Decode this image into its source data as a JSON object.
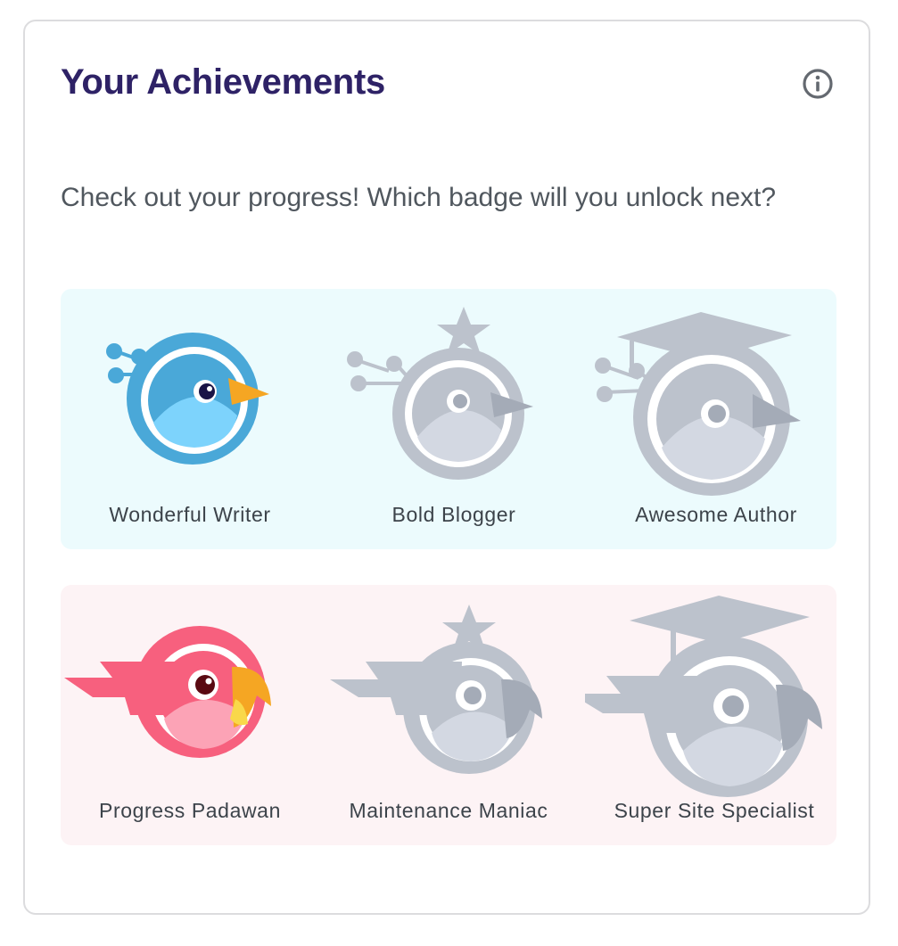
{
  "card": {
    "title": "Your Achievements",
    "info_icon": "info-circle-icon",
    "description": "Check out your progress! Which badge will you unlock next?"
  },
  "colors": {
    "title": "#2e2266",
    "locked_gray": "#bcc2cc",
    "writer_blue": "#4aa8d8",
    "padawan_pink": "#f7607e",
    "panel_blue_bg": "#ecfbfd",
    "panel_pink_bg": "#fdf3f5"
  },
  "badge_rows": [
    {
      "theme": "blue",
      "badges": [
        {
          "name": "Wonderful Writer",
          "icon": "writer-bird-icon",
          "unlocked": true
        },
        {
          "name": "Bold Blogger",
          "icon": "blogger-bird-star-icon",
          "unlocked": false
        },
        {
          "name": "Awesome Author",
          "icon": "author-bird-graduation-cap-icon",
          "unlocked": false
        }
      ]
    },
    {
      "theme": "pink",
      "badges": [
        {
          "name": "Progress Padawan",
          "icon": "padawan-parrot-icon",
          "unlocked": true
        },
        {
          "name": "Maintenance Maniac",
          "icon": "maniac-parrot-star-icon",
          "unlocked": false
        },
        {
          "name": "Super Site Specialist",
          "icon": "specialist-parrot-graduation-cap-icon",
          "unlocked": false
        }
      ]
    }
  ]
}
